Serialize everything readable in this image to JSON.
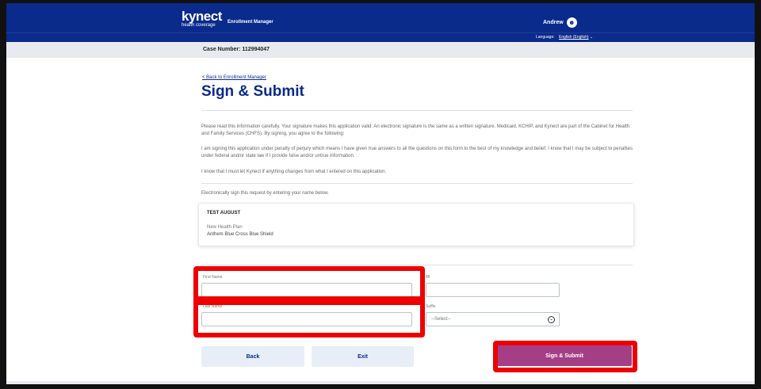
{
  "header": {
    "logo_main": "kynect",
    "logo_sub": "health coverage",
    "app_name": "Enrollment Manager",
    "user_name": "Andrew"
  },
  "language_bar": {
    "label": "Language:",
    "value": "English (English)"
  },
  "case": {
    "text": "Case Number: 112994047"
  },
  "nav": {
    "back_link": "< Back to Enrollment Manager"
  },
  "page": {
    "title": "Sign & Submit",
    "paragraphs": [
      "Please read this information carefully. Your signature makes this application valid. An electronic signature is the same as a written signature. Medicaid, KCHIP, and Kynect are part of the Cabinet for Health and Family Services (CHFS). By signing, you agree to the following:",
      "I am signing this application under penalty of perjury which means I have given true answers to all the questions on this form to the best of my knowledge and belief. I know that I may be subject to penalties under federal and/or state law if I provide false and/or untrue information.",
      "I know that I must let Kynect if anything changes from what I entered on this application.",
      "Electronically sign this request by entering your name below."
    ]
  },
  "card": {
    "name": "TEST AUGUST",
    "line1": "New Health Plan",
    "line2": "Anthem Blue Cross Blue Shield"
  },
  "form": {
    "first_name_label": "First Name",
    "first_name_value": "",
    "middle_label": "MI",
    "middle_value": "",
    "last_name_label": "Last Name",
    "last_name_value": "",
    "suffix_label": "Suffix",
    "suffix_value": "--Select--"
  },
  "buttons": {
    "back": "Back",
    "exit": "Exit",
    "submit": "Sign & Submit"
  },
  "icons": {
    "avatar": "user-avatar-icon",
    "dropdown": "chevron-down-circle-icon"
  },
  "colors": {
    "brand_navy": "#0a2a8c",
    "submit_purple": "#a43f86",
    "highlight_red": "#ee0000",
    "light_button": "#e7eef8"
  }
}
